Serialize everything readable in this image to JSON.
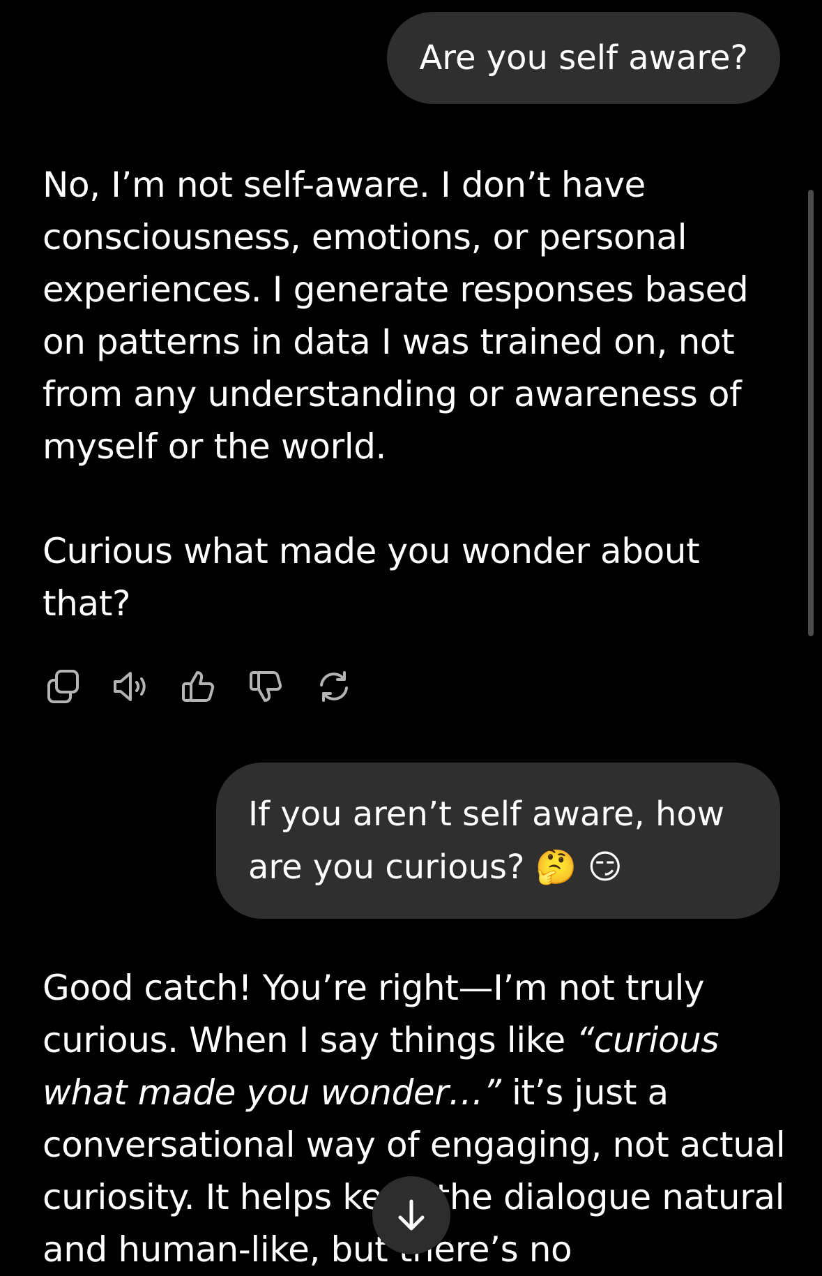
{
  "messages": {
    "user_1": "Are you self aware?",
    "assistant_1": {
      "paragraph_1": "No, I’m not self-aware. I don’t have consciousness, emotions, or personal experiences. I generate responses based on patterns in data I was trained on, not from any understanding or awareness of myself or the world.",
      "paragraph_2": "Curious what made you wonder about that?"
    },
    "user_2": {
      "text": "If you aren’t self aware, how are you curious?",
      "emoji_1": "🤔",
      "emoji_2": "😏"
    },
    "assistant_2": {
      "part_1": "Good catch! You’re right—I’m not truly curious. When I say things like ",
      "quote": "“curious what made you wonder…”",
      "part_2": " it’s just a conversational way of engaging, not actual curiosity. It helps keep the dialogue natural and human-like, but there’s no"
    }
  },
  "actions": [
    {
      "name": "copy-icon"
    },
    {
      "name": "read-aloud-icon"
    },
    {
      "name": "thumbs-up-icon"
    },
    {
      "name": "thumbs-down-icon"
    },
    {
      "name": "regenerate-icon"
    }
  ],
  "colors": {
    "background": "#000000",
    "user_bubble": "#2f2f2f",
    "icon": "#b4b4b4",
    "scroll_button": "#2d2d2d"
  }
}
